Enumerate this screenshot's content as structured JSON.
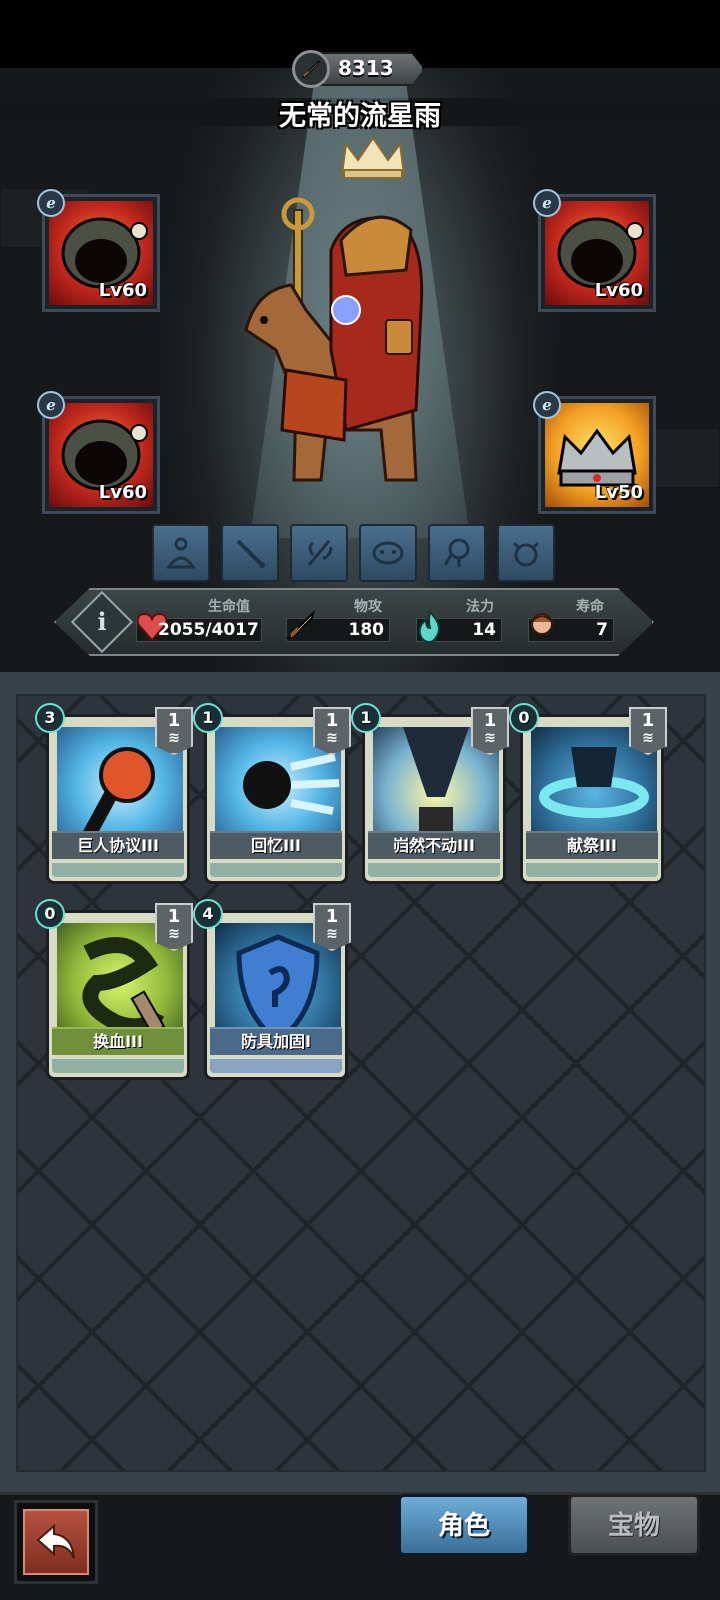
{
  "hero": {
    "power": "8313",
    "name": "无常的流星雨"
  },
  "equipment": [
    {
      "level": "Lv60",
      "tag": "ℯ",
      "kind": "cursed-helm",
      "color": "red"
    },
    {
      "level": "Lv60",
      "tag": "ℯ",
      "kind": "cursed-helm",
      "color": "red"
    },
    {
      "level": "Lv60",
      "tag": "ℯ",
      "kind": "cursed-helm",
      "color": "red"
    },
    {
      "level": "Lv50",
      "tag": "ℯ",
      "kind": "crown",
      "color": "gold"
    }
  ],
  "skill_slots": [
    "meditate-icon",
    "sword-icon",
    "herb-icon",
    "face-icon",
    "skull-icon",
    "demon-icon"
  ],
  "stats": {
    "hp": {
      "label": "生命值",
      "value": "2055/4017"
    },
    "atk": {
      "label": "物攻",
      "value": "180"
    },
    "mana": {
      "label": "法力",
      "value": "14"
    },
    "life": {
      "label": "寿命",
      "value": "7"
    }
  },
  "cards": [
    {
      "name": "巨人协议III",
      "cost": "3",
      "count": "1",
      "stars": 3,
      "art": "fist-icon"
    },
    {
      "name": "回忆III",
      "cost": "1",
      "count": "1",
      "stars": 3,
      "art": "ghost-icon"
    },
    {
      "name": "岿然不动III",
      "cost": "1",
      "count": "1",
      "stars": 3,
      "art": "statue-icon"
    },
    {
      "name": "献祭III",
      "cost": "0",
      "count": "1",
      "stars": 3,
      "art": "sacrifice-icon"
    },
    {
      "name": "换血III",
      "cost": "0",
      "count": "1",
      "stars": 3,
      "art": "blood-swap-icon"
    },
    {
      "name": "防具加固I",
      "cost": "4",
      "count": "1",
      "stars": 1,
      "art": "shield-icon"
    }
  ],
  "tabs": {
    "role": "角色",
    "treasure": "宝物"
  },
  "colors": {
    "stat_panel": "#3c4547",
    "card_grid": "#2d343b",
    "tab_active": "#4f8fbf"
  }
}
